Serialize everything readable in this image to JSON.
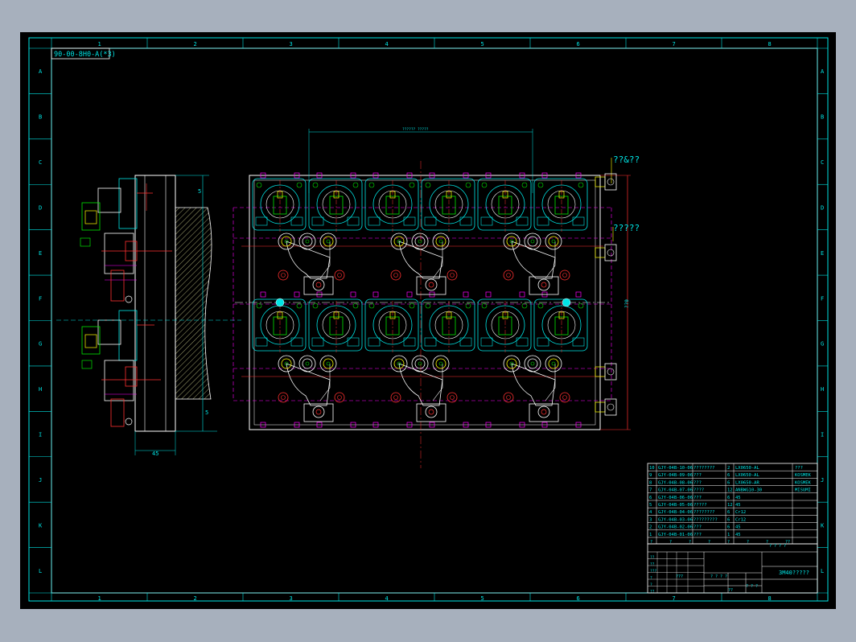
{
  "drawing": {
    "tag_code": "90-00-8H0-A(*3)",
    "col_labels": [
      "1",
      "2",
      "3",
      "4",
      "5",
      "6",
      "7",
      "8"
    ],
    "row_labels": [
      "A",
      "B",
      "C",
      "D",
      "E",
      "F",
      "G",
      "H",
      "I",
      "J",
      "K",
      "L"
    ],
    "annotations": {
      "top_dim": "?????? ?????",
      "right_top": "??&??",
      "right_mid": "?????",
      "right_dim": "??0",
      "left_dim_bottom": "45",
      "left_dim_right_top": "5",
      "left_dim_right_bottom": "5"
    }
  },
  "bom": {
    "rows": [
      {
        "no": "10",
        "code": "GJY-04B-10-06",
        "name": "????????",
        "qty": "2",
        "material": "LX0650-AL",
        "note": "???"
      },
      {
        "no": "9",
        "code": "GJY-04B-09-06",
        "name": "???",
        "qty": "6",
        "material": "LX0650-AL",
        "note": "KOSMEK"
      },
      {
        "no": "8",
        "code": "GJY-04B-08-06",
        "name": "???",
        "qty": "6",
        "material": "LX0650-AR",
        "note": "KOSMEK"
      },
      {
        "no": "7",
        "code": "GJY-04B-07-06",
        "name": "????",
        "qty": "12",
        "material": "ANBWG10-30",
        "note": "MISUMI"
      },
      {
        "no": "6",
        "code": "GJY-04B-06-06",
        "name": "???",
        "qty": "6",
        "material": "45",
        "note": ""
      },
      {
        "no": "5",
        "code": "GJY-04B-05-06",
        "name": "?????",
        "qty": "12",
        "material": "45",
        "note": ""
      },
      {
        "no": "4",
        "code": "GJY-04B-04-06",
        "name": "????????",
        "qty": "6",
        "material": "Cr12",
        "note": ""
      },
      {
        "no": "3",
        "code": "GJY-04B-03-06",
        "name": "?????????",
        "qty": "6",
        "material": "Cr12",
        "note": ""
      },
      {
        "no": "2",
        "code": "GJY-04B-02-06",
        "name": "???",
        "qty": "6",
        "material": "45",
        "note": ""
      },
      {
        "no": "1",
        "code": "GJY-04B-01-06",
        "name": "???",
        "qty": "1",
        "material": "45",
        "note": ""
      }
    ],
    "header": [
      "?",
      "?",
      "?",
      "?",
      "?",
      "?",
      "?",
      "??"
    ]
  },
  "title_block": {
    "title": "3M40?????",
    "scale_label": "???",
    "marks": [
      "??",
      "??",
      "???",
      "?",
      "?",
      "??"
    ],
    "sheet": "??",
    "small1": "? ? ? ?",
    "small2": "? ? ? ?",
    "small3": "? ? ?"
  }
}
